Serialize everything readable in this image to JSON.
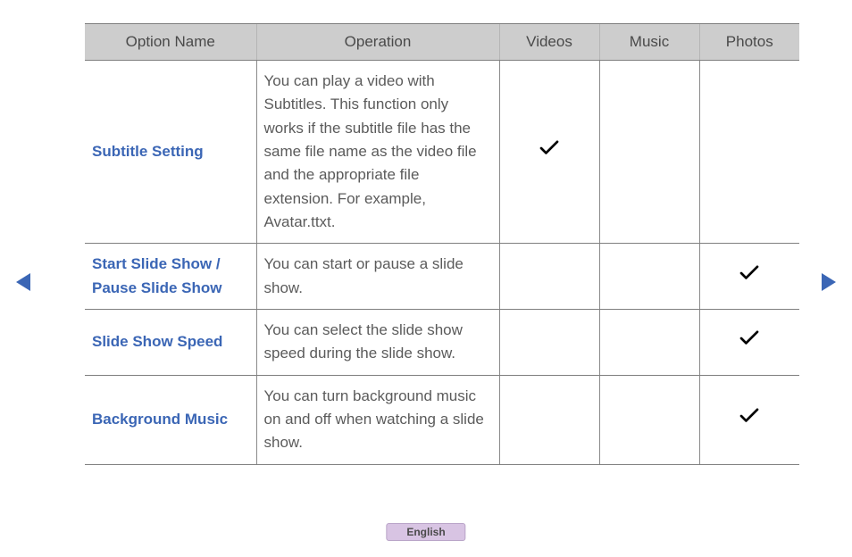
{
  "table": {
    "headers": [
      "Option Name",
      "Operation",
      "Videos",
      "Music",
      "Photos"
    ],
    "rows": [
      {
        "option": "Subtitle Setting",
        "operation": "You can play a video with Subtitles. This function only works if the subtitle file has the same file name as the video file and the appropriate file extension. For example, Avatar.ttxt.",
        "videos": true,
        "music": false,
        "photos": false
      },
      {
        "option": "Start Slide Show / Pause Slide Show",
        "operation": "You can start or pause a slide show.",
        "videos": false,
        "music": false,
        "photos": true
      },
      {
        "option": "Slide Show Speed",
        "operation": "You can select the slide show speed during the slide show.",
        "videos": false,
        "music": false,
        "photos": true
      },
      {
        "option": "Background Music",
        "operation": "You can turn background music on and off when watching a slide show.",
        "videos": false,
        "music": false,
        "photos": true
      }
    ]
  },
  "footer": {
    "language": "English"
  }
}
